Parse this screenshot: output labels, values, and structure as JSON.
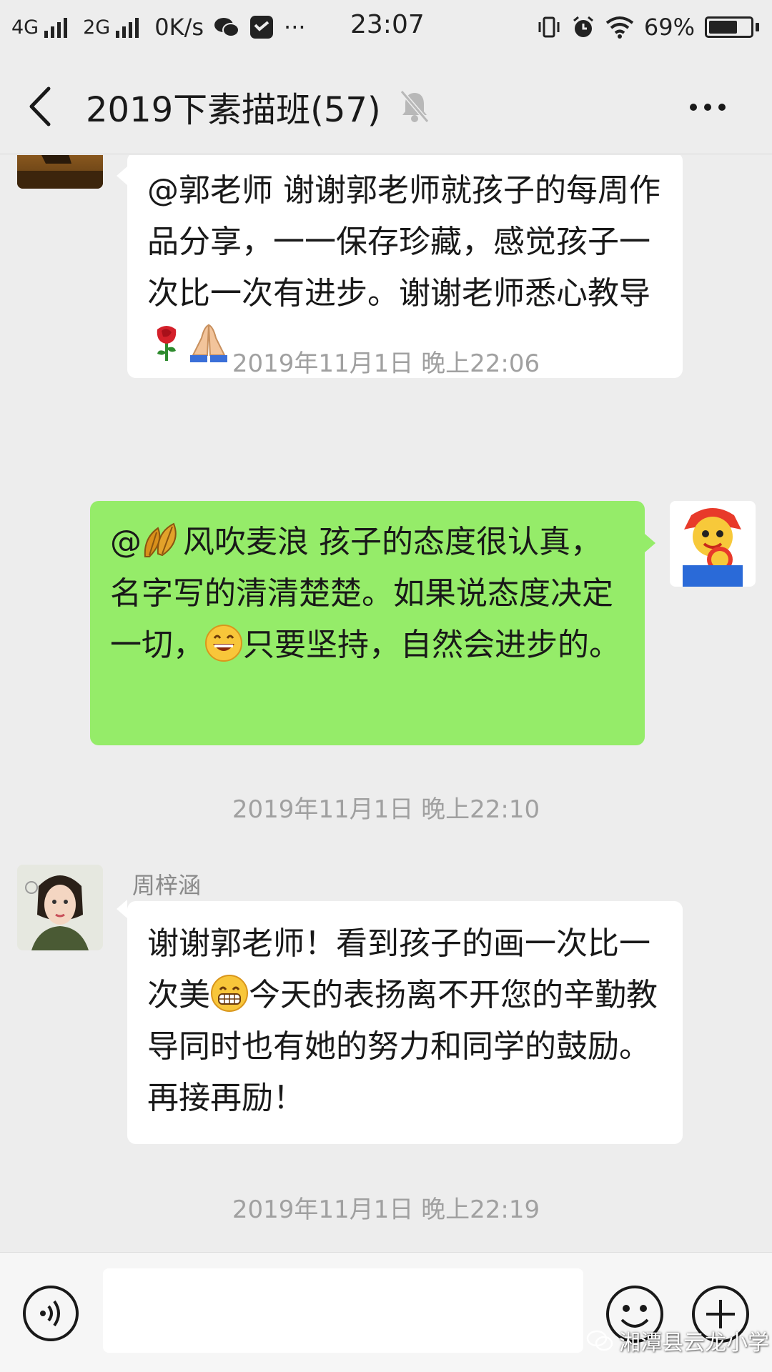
{
  "status_bar": {
    "net1": "4G",
    "net2": "2G",
    "speed": "0K/s",
    "more": "···",
    "time": "23:07",
    "battery": "69%",
    "battery_level": 0.69
  },
  "header": {
    "title": "2019下素描班(57)"
  },
  "messages": [
    {
      "text_1": "@郭老师  谢谢郭老师就孩子的每周作品分享，一一保存珍藏，感觉孩子一次比一次有进步。谢谢老师悉心教导",
      "emoji": [
        "rose-emoji",
        "folded-hands-emoji"
      ]
    },
    {
      "timestamp": "2019年11月1日 晚上22:06",
      "text_1": "@",
      "text_2": "风吹麦浪  孩子的态度很认真，名字写的清清楚楚。如果说态度决定一切，",
      "text_3": "只要坚持，自然会进步的。",
      "emoji": [
        "leaves-emoji",
        "smiling-face-emoji"
      ]
    },
    {
      "timestamp": "2019年11月1日 晚上22:10",
      "sender": "周梓涵",
      "text_1": "谢谢郭老师！看到孩子的画一次比一次美",
      "text_2": "今天的表扬离不开您的辛勤教导同时也有她的努力和同学的鼓励。再接再励！",
      "emoji": [
        "grinning-face-emoji"
      ]
    },
    {
      "timestamp": "2019年11月1日 晚上22:19"
    }
  ],
  "watermark": "湘潭县云龙小学",
  "colors": {
    "background": "#ededed",
    "self_bubble": "#95ec69",
    "other_bubble": "#ffffff",
    "timestamp": "#a0a0a0"
  }
}
